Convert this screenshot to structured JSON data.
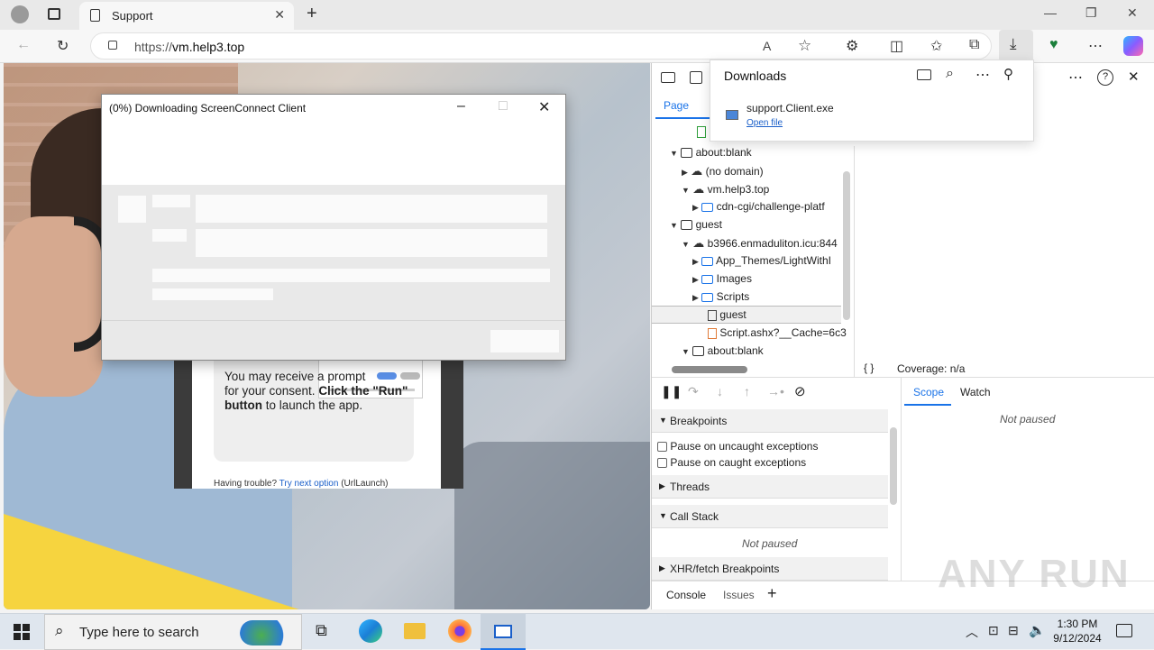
{
  "browser": {
    "tab_title": "Support",
    "url_prefix": "https://",
    "url_host": "vm.help3.top"
  },
  "web_page": {
    "consent_text_1": "You may receive a prompt",
    "consent_text_2": "for your consent. ",
    "consent_bold_1": "Click the \"Run\" button",
    "consent_text_3": " to launch the app.",
    "trouble_text": "Having trouble? ",
    "trouble_link": "Try next option",
    "trouble_suffix": " (UrlLaunch)"
  },
  "download_dialog": {
    "title": "(0%) Downloading ScreenConnect Client"
  },
  "downloads_panel": {
    "title": "Downloads",
    "file_name": "support.Client.exe",
    "open_label": "Open file"
  },
  "devtools": {
    "page_tab": "Page",
    "tree": [
      {
        "label": "about:blank"
      },
      {
        "label": "(no domain)"
      },
      {
        "label": "vm.help3.top"
      },
      {
        "label": "cdn-cgi/challenge-platf"
      },
      {
        "label": "guest"
      },
      {
        "label": "b3966.enmaduliton.icu:844"
      },
      {
        "label": "App_Themes/LightWithI"
      },
      {
        "label": "Images"
      },
      {
        "label": "Scripts"
      },
      {
        "label": "guest"
      },
      {
        "label": "Script.ashx?__Cache=6c3"
      },
      {
        "label": "about:blank"
      }
    ],
    "coverage": "Coverage: n/a",
    "braces": "{ }",
    "breakpoints": "Breakpoints",
    "pause_uncaught": "Pause on uncaught exceptions",
    "pause_caught": "Pause on caught exceptions",
    "threads": "Threads",
    "call_stack": "Call Stack",
    "not_paused": "Not paused",
    "xhr": "XHR/fetch Breakpoints",
    "scope_tab": "Scope",
    "watch_tab": "Watch",
    "scope_not_paused": "Not paused",
    "console_tab": "Console",
    "issues_tab": "Issues"
  },
  "taskbar": {
    "search_placeholder": "Type here to search",
    "time": "1:30 PM",
    "date": "9/12/2024"
  },
  "watermark": "ANY RUN"
}
